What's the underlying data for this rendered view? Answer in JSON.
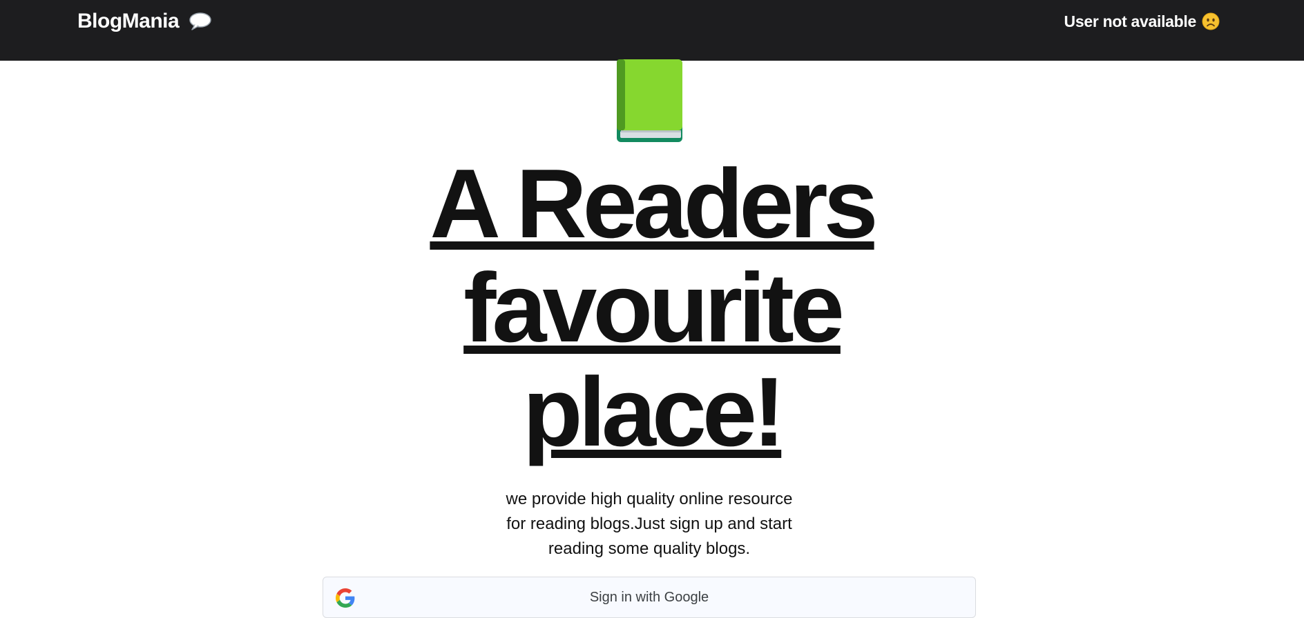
{
  "navbar": {
    "brand": "BlogMania",
    "brand_icon": "speech-balloon-icon",
    "user_status": "User not available",
    "user_status_icon": "frowning-face-icon",
    "background": "#1d1d1f"
  },
  "hero": {
    "icon": "green-book-icon",
    "title_lines": [
      "A Readers",
      "favourite",
      "place!"
    ],
    "subtitle_lines": [
      "we provide high quality online resource",
      "for reading blogs.Just sign up and start",
      "reading some quality blogs."
    ]
  },
  "auth": {
    "google_button_label": "Sign in with Google",
    "google_icon": "google-g-icon"
  }
}
